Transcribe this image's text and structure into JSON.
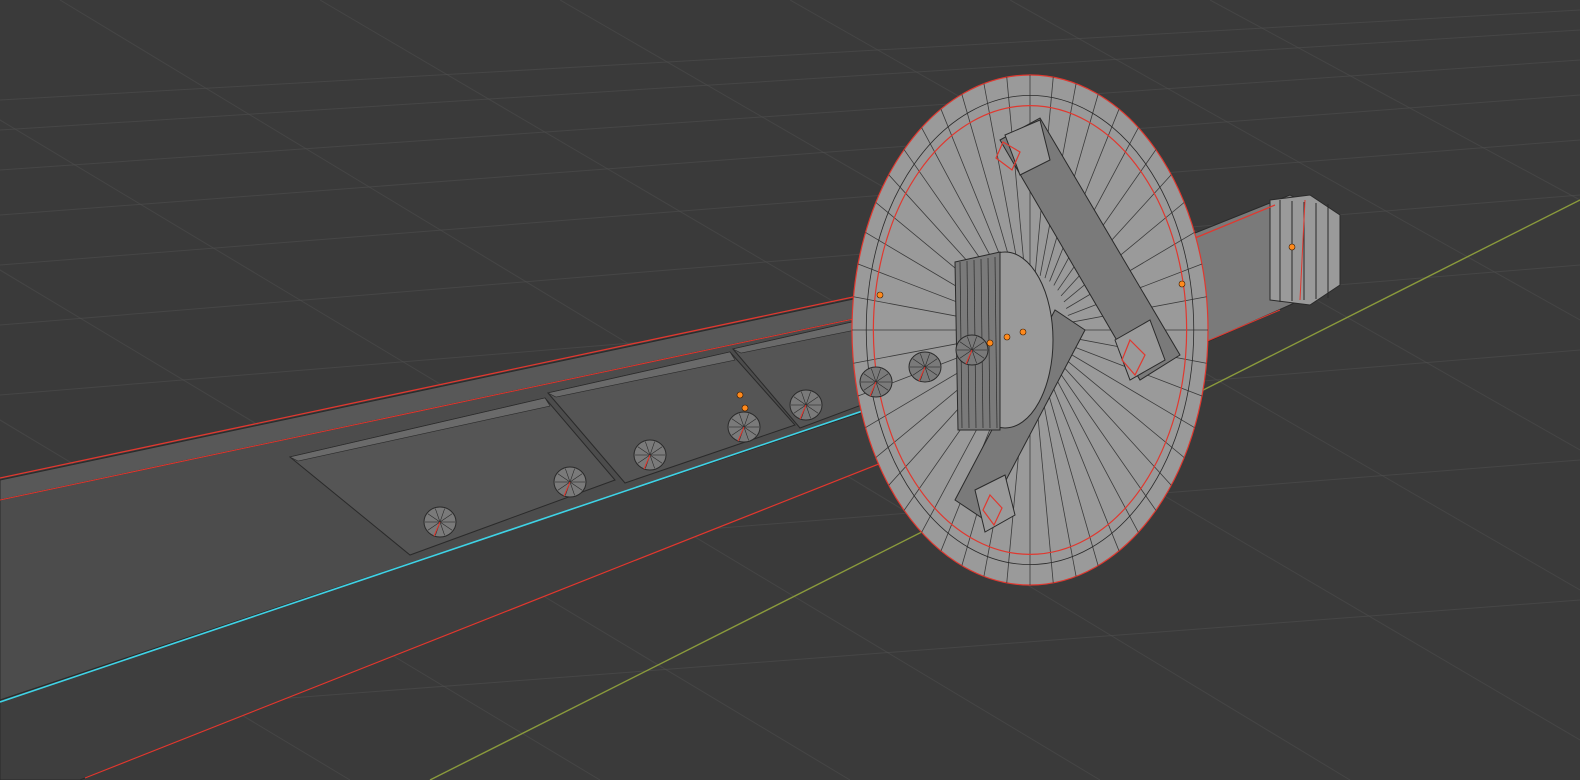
{
  "viewport": {
    "mode": "edit-mode",
    "shading": "solid"
  },
  "colors": {
    "background": "#3a3a3a",
    "grid_line": "#505050",
    "x_axis": "#8a9a3c",
    "y_axis": "#8a9a3c",
    "mesh_face_light": "#9a9a9a",
    "mesh_face_mid": "#7a7a7a",
    "mesh_face_dark": "#585858",
    "blade_top": "#4c4c4c",
    "blade_side": "#424242",
    "wireframe": "#2a2a2a",
    "seam": "#e0382f",
    "selected_edge": "#3fd3e6",
    "vertex_dot": "#ff8a1c"
  },
  "objects": {
    "blade": {
      "name": "blade",
      "icon": "mesh-object-icon"
    },
    "guard": {
      "name": "guard",
      "icon": "mesh-object-icon"
    },
    "handle": {
      "name": "handle",
      "icon": "mesh-object-icon"
    },
    "rivets": {
      "count": 9,
      "icon": "rivet-icon"
    }
  }
}
